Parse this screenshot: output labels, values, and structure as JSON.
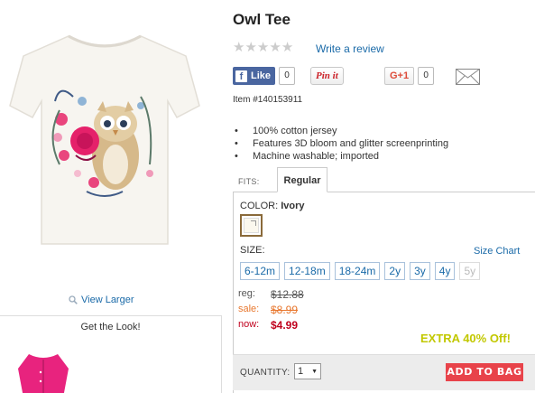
{
  "product": {
    "title": "Owl Tee",
    "item_number": "Item #140153911",
    "rating_stars": 5,
    "rating_filled": 0,
    "write_review": "Write a review"
  },
  "social": {
    "like_label": "Like",
    "like_count": "0",
    "pin_label": "Pin it",
    "gplus_label": "G+1",
    "gplus_count": "0"
  },
  "features": [
    "100% cotton jersey",
    "Features 3D bloom and glitter screenprinting",
    "Machine washable; imported"
  ],
  "fits": {
    "label": "FITS:",
    "tab": "Regular"
  },
  "color": {
    "label": "COLOR:",
    "value": "Ivory",
    "swatch_hex": "#fbf8ee"
  },
  "size": {
    "label": "SIZE:",
    "chart_link": "Size Chart",
    "options": [
      {
        "label": "6-12m",
        "available": true
      },
      {
        "label": "12-18m",
        "available": true
      },
      {
        "label": "18-24m",
        "available": true
      },
      {
        "label": "2y",
        "available": true
      },
      {
        "label": "3y",
        "available": true
      },
      {
        "label": "4y",
        "available": true
      },
      {
        "label": "5y",
        "available": false
      }
    ]
  },
  "price": {
    "reg_label": "reg:",
    "reg_value": "$12.88",
    "sale_label": "sale:",
    "sale_value": "$8.99",
    "now_label": "now:",
    "now_value": "$4.99",
    "promo": "EXTRA 40% Off!"
  },
  "purchase": {
    "quantity_label": "QUANTITY:",
    "quantity_value": "1",
    "add_to_bag": "ADD TO BAG"
  },
  "left": {
    "view_larger": "View Larger",
    "get_look": "Get the Look!"
  },
  "colors": {
    "link": "#1a6aa8",
    "sale": "#e8772e",
    "now": "#c0001d",
    "promo": "#c2c800",
    "add_to_bag": "#e8434a",
    "facebook": "#4a66a0"
  }
}
